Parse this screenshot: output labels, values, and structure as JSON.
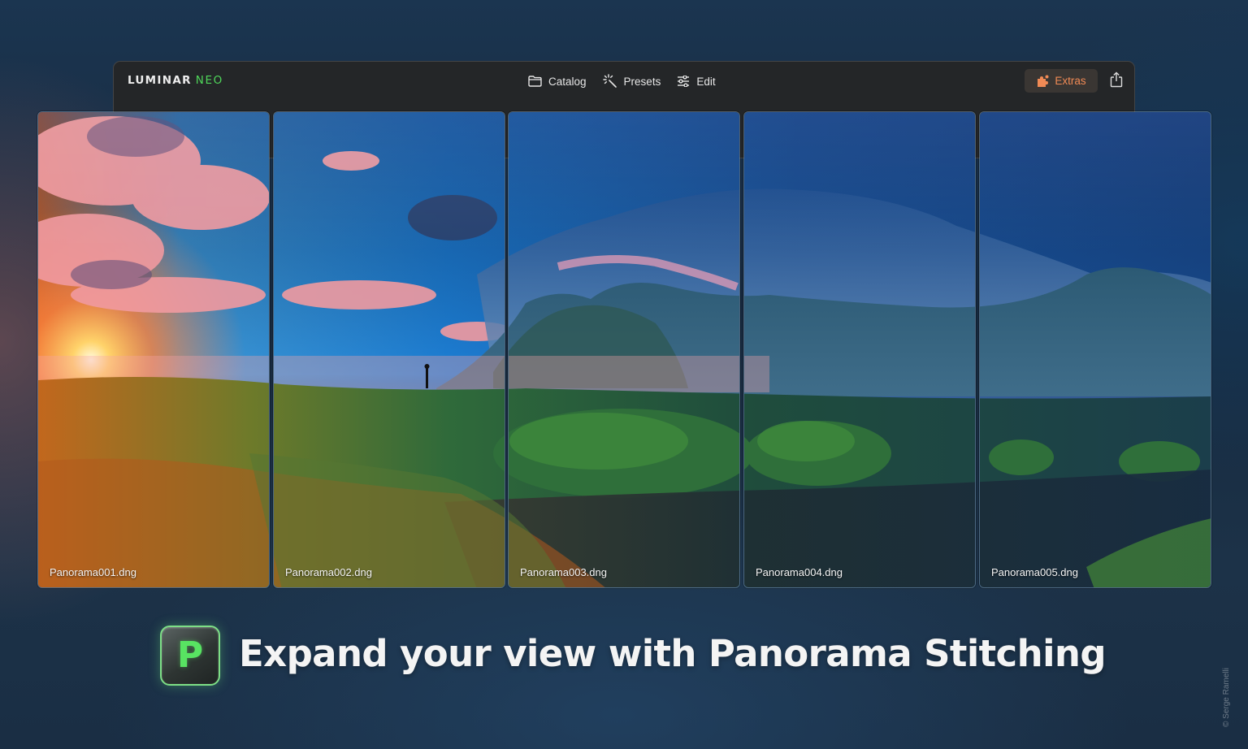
{
  "app": {
    "logo_main": "LUMINAR",
    "logo_accent": "NEO",
    "nav": [
      {
        "label": "Catalog",
        "icon": "folder-icon"
      },
      {
        "label": "Presets",
        "icon": "sparkle-wand-icon"
      },
      {
        "label": "Edit",
        "icon": "sliders-icon"
      }
    ],
    "extras_label": "Extras",
    "extras_icon": "puzzle-icon",
    "share_icon": "share-icon"
  },
  "panels": [
    {
      "filename": "Panorama001.dng"
    },
    {
      "filename": "Panorama002.dng"
    },
    {
      "filename": "Panorama003.dng"
    },
    {
      "filename": "Panorama004.dng"
    },
    {
      "filename": "Panorama005.dng"
    }
  ],
  "feature": {
    "icon_letter": "P",
    "headline": "Expand your view with Panorama Stitching"
  },
  "credit": "© Serge Ramelli",
  "colors": {
    "accent_green": "#4fd65a",
    "extras_orange": "#f08a55",
    "window_bg": "#242628"
  }
}
